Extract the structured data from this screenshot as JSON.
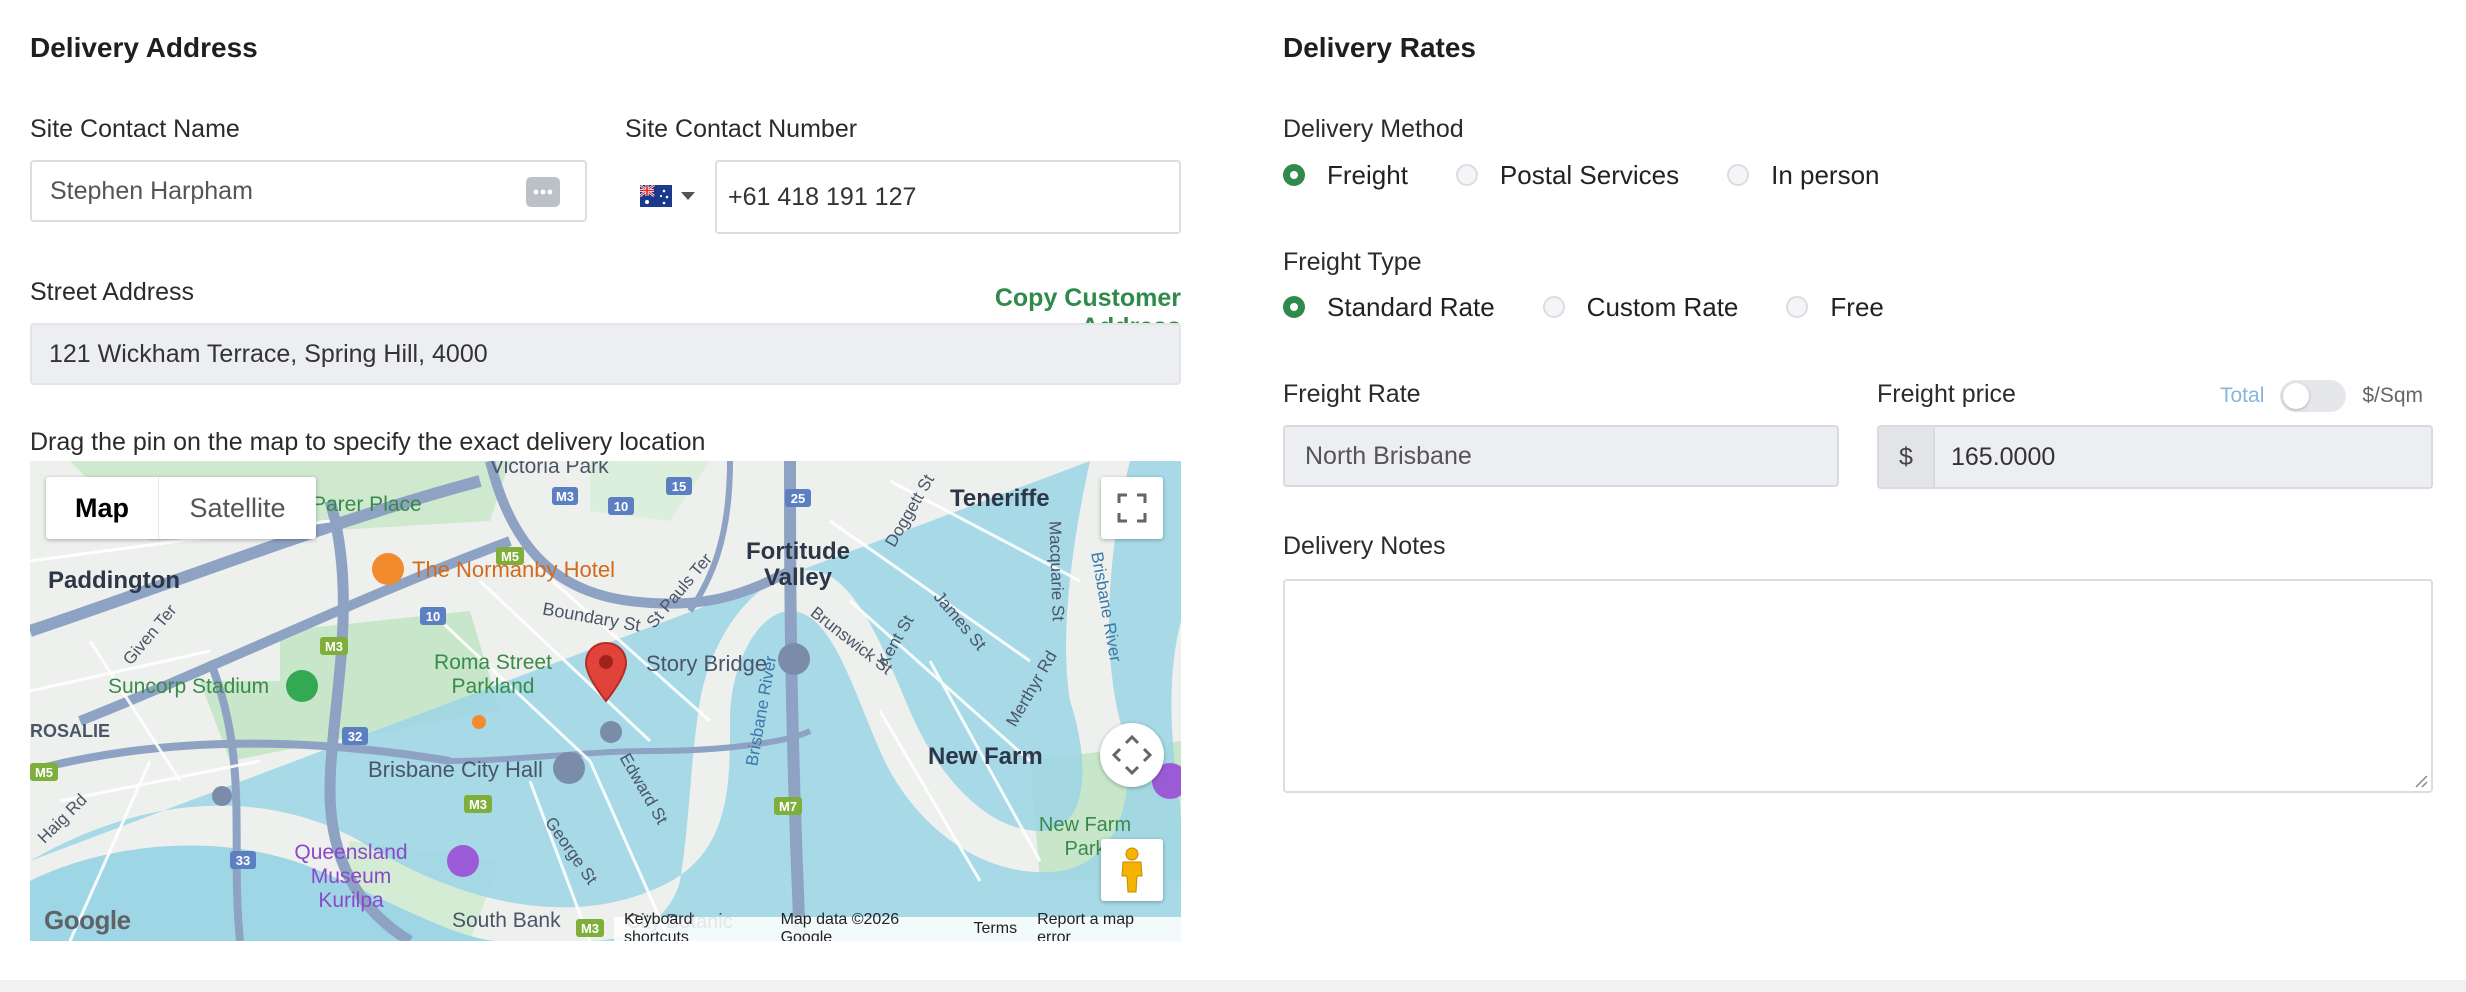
{
  "delivery_address": {
    "title": "Delivery Address",
    "site_contact_name_label": "Site Contact Name",
    "site_contact_name_value": "Stephen Harpham",
    "site_contact_number_label": "Site Contact Number",
    "site_contact_number_value": "+61 418 191 127",
    "street_address_label": "Street Address",
    "copy_customer_address": "Copy Customer Address",
    "street_address_value": "121 Wickham Terrace, Spring Hill, 4000",
    "map_instruction": "Drag the pin on the map to specify the exact delivery location"
  },
  "map": {
    "tab_map": "Map",
    "tab_satellite": "Satellite",
    "places": [
      "Victoria Park",
      "Parer Place",
      "Teneriffe",
      "Fortitude Valley",
      "Paddington",
      "The Normanby Hotel",
      "Boundary St",
      "St Pauls Ter",
      "Roma Street Parkland",
      "Story Bridge",
      "Suncorp Stadium",
      "ROSALIE",
      "Brisbane City Hall",
      "New Farm",
      "New Farm Park",
      "Queensland Museum Kurilpa",
      "South Bank",
      "Edward St",
      "George St",
      "Brisbane River",
      "Macquarie St",
      "Merthyr Rd",
      "James St",
      "Kent St",
      "Brunswick St",
      "Doggett St",
      "Given Ter",
      "Haig Rd",
      "City Botanic"
    ],
    "road_badges": [
      "M3",
      "10",
      "15",
      "25",
      "M5",
      "10",
      "M3",
      "32",
      "M5",
      "M3",
      "33",
      "M7",
      "M3"
    ],
    "footer": [
      "Keyboard shortcuts",
      "Map data ©2026 Google",
      "Terms",
      "Report a map error"
    ],
    "logo": "Google"
  },
  "delivery_rates": {
    "title": "Delivery Rates",
    "delivery_method_label": "Delivery Method",
    "delivery_methods": [
      "Freight",
      "Postal Services",
      "In person"
    ],
    "delivery_method_selected": "Freight",
    "freight_type_label": "Freight Type",
    "freight_types": [
      "Standard Rate",
      "Custom Rate",
      "Free"
    ],
    "freight_type_selected": "Standard Rate",
    "freight_rate_label": "Freight Rate",
    "freight_rate_value": "North Brisbane",
    "freight_price_label": "Freight price",
    "toggle_left": "Total",
    "toggle_right": "$/Sqm",
    "currency_symbol": "$",
    "freight_price_value": "165.0000",
    "delivery_notes_label": "Delivery Notes",
    "delivery_notes_value": ""
  },
  "colors": {
    "accent_green": "#2f8a4b",
    "toggle_label_blue": "#86b6e0",
    "map_water": "#9fd6e6",
    "map_park": "#c8e6c9",
    "pin_red": "#e0433a"
  },
  "icons": [
    "contact-card-icon",
    "australia-flag-icon",
    "chevron-down-icon",
    "fullscreen-icon",
    "map-pin-icon",
    "pan-control-icon",
    "pegman-icon",
    "resize-handle-icon"
  ]
}
